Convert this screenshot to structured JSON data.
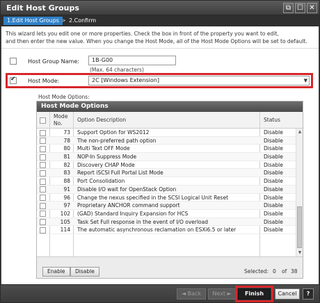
{
  "window": {
    "title": "Edit Host Groups",
    "buttons": {
      "restore": "⧉",
      "maximize": "☐",
      "close": "✕"
    }
  },
  "steps": {
    "active": "1.Edit Host Groups",
    "separator": ">",
    "next": "2.Confirm"
  },
  "instructions": {
    "line1": "This wizard lets you edit one or more properties. Check the  box in front of the property you want to edit,",
    "line2": "and then enter the new value. When you change the Host Mode, all of the Host Mode Options will be set to default."
  },
  "form": {
    "host_group_name": {
      "label": "Host Group Name:",
      "value": "1B-G00",
      "hint": "(Max. 64 characters)",
      "checked": false
    },
    "host_mode": {
      "label": "Host Mode:",
      "value": "2C [Windows Extension]",
      "checked": true
    }
  },
  "host_mode_options": {
    "section_label": "Host Mode Options:",
    "panel_title": "Host Mode Options",
    "columns": {
      "mode_line1": "Mode",
      "mode_line2": "No.",
      "description": "Option Description",
      "status": "Status"
    },
    "rows": [
      {
        "mode": "73",
        "description": "Support Option for WS2012",
        "status": "Disable"
      },
      {
        "mode": "78",
        "description": "The non-preferred path option",
        "status": "Disable"
      },
      {
        "mode": "80",
        "description": "Multi Text OFF Mode",
        "status": "Disable"
      },
      {
        "mode": "81",
        "description": "NOP-In Suppress Mode",
        "status": "Disable"
      },
      {
        "mode": "82",
        "description": "Discovery CHAP Mode",
        "status": "Disable"
      },
      {
        "mode": "83",
        "description": "Report iSCSI Full Portal List Mode",
        "status": "Disable"
      },
      {
        "mode": "88",
        "description": "Port Consolidation",
        "status": "Disable"
      },
      {
        "mode": "91",
        "description": "Disable I/O wait for OpenStack Option",
        "status": "Disable"
      },
      {
        "mode": "96",
        "description": "Change the nexus specified in the SCSI Logical Unit Reset",
        "status": "Disable"
      },
      {
        "mode": "97",
        "description": "Proprietary ANCHOR command support",
        "status": "Disable"
      },
      {
        "mode": "102",
        "description": "(GAD) Standard Inquiry Expansion for HCS",
        "status": "Disable"
      },
      {
        "mode": "105",
        "description": "Task Set Full response in the event of I/O overload",
        "status": "Disable"
      },
      {
        "mode": "114",
        "description": "The automatic asynchronous reclamation on ESXi6.5 or later",
        "status": "Disable"
      }
    ],
    "enable_label": "Enable",
    "disable_label": "Disable",
    "selected_label": "Selected:",
    "selected_count": "0",
    "of_label": "of",
    "total_count": "38"
  },
  "footer": {
    "back_label": "◄ Back",
    "next_label": "Next ►",
    "finish_label": "Finish",
    "cancel_label": "Cancel",
    "help_label": "?"
  },
  "colors": {
    "highlight": "#d6262c",
    "step_active": "#2f80c8"
  }
}
